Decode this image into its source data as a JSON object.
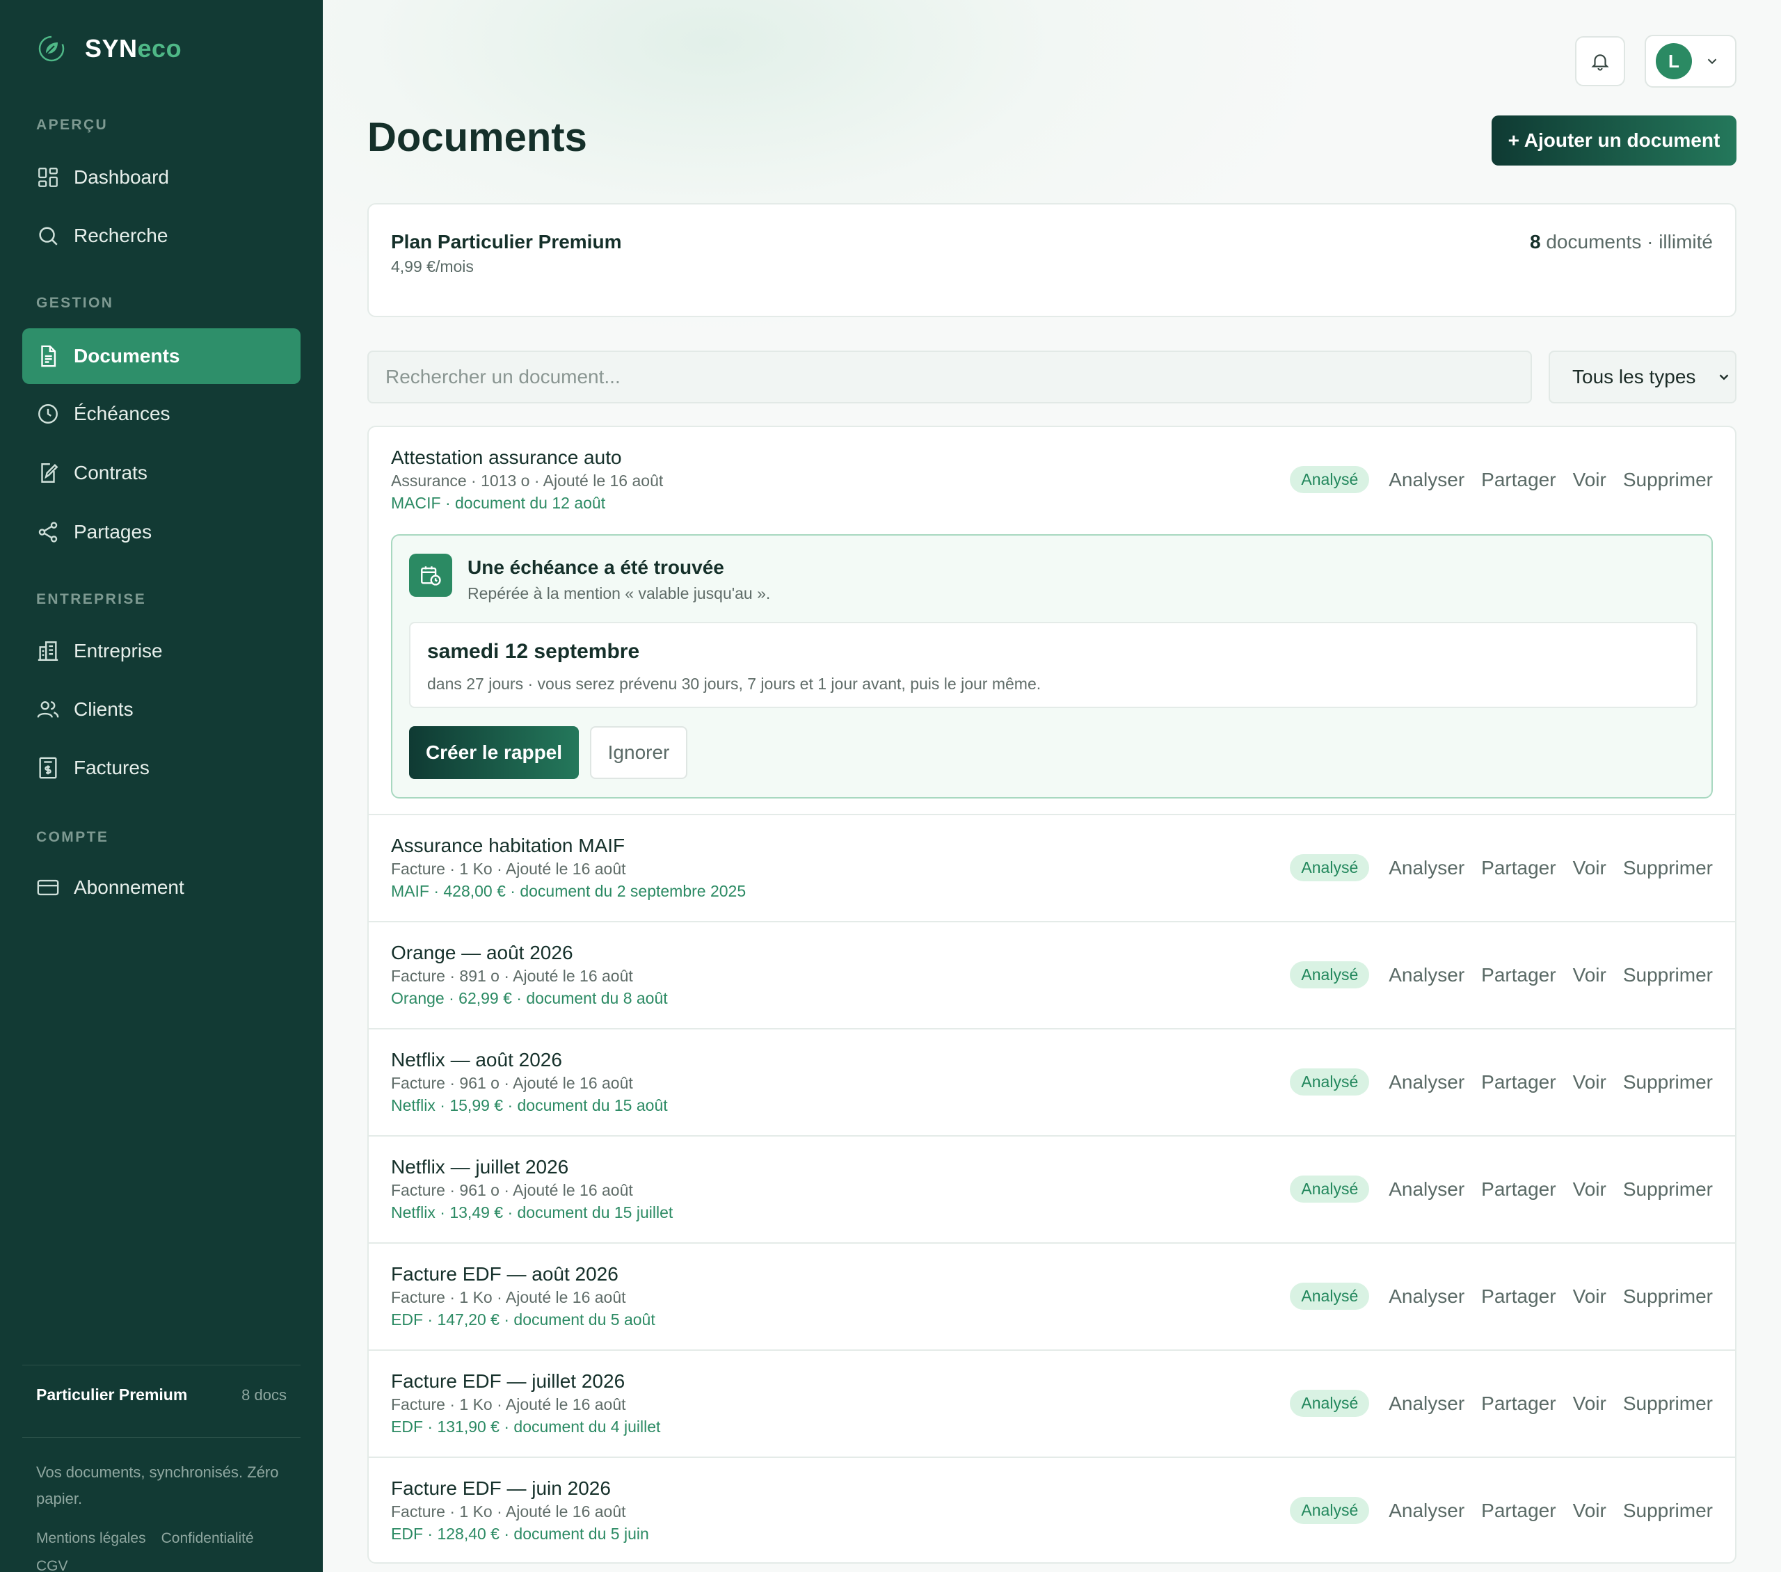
{
  "brand": {
    "name_main": "SYN",
    "name_accent": "eco"
  },
  "sidebar": {
    "sections": [
      {
        "label": "APERÇU"
      },
      {
        "label": "GESTION"
      },
      {
        "label": "ENTREPRISE"
      },
      {
        "label": "COMPTE"
      }
    ],
    "items": [
      {
        "label": "Dashboard",
        "icon": "dashboard-icon"
      },
      {
        "label": "Recherche",
        "icon": "search-icon"
      },
      {
        "label": "Documents",
        "icon": "document-icon",
        "active": true
      },
      {
        "label": "Échéances",
        "icon": "clock-icon"
      },
      {
        "label": "Contrats",
        "icon": "contract-icon"
      },
      {
        "label": "Partages",
        "icon": "share-icon"
      },
      {
        "label": "Entreprise",
        "icon": "building-icon"
      },
      {
        "label": "Clients",
        "icon": "users-icon"
      },
      {
        "label": "Factures",
        "icon": "invoice-icon"
      },
      {
        "label": "Abonnement",
        "icon": "credit-card-icon"
      }
    ],
    "plan": {
      "name": "Particulier Premium",
      "count": "8 docs"
    },
    "tagline": "Vos documents, synchronisés. Zéro papier.",
    "legal": [
      "Mentions légales",
      "Confidentialité",
      "CGV"
    ]
  },
  "header": {
    "user_initial": "L"
  },
  "page": {
    "title": "Documents",
    "add_button": "+ Ajouter un document"
  },
  "plan_card": {
    "name": "Plan Particulier Premium",
    "price": "4,99 €/mois",
    "doc_count": "8",
    "doc_suffix": "documents · illimité"
  },
  "search": {
    "placeholder": "Rechercher un document..."
  },
  "filter": {
    "selected": "Tous les types"
  },
  "actions": {
    "badge": "Analysé",
    "analyze": "Analyser",
    "share": "Partager",
    "view": "Voir",
    "delete": "Supprimer"
  },
  "documents": [
    {
      "title": "Attestation assurance auto",
      "meta": "Assurance · 1013 o · Ajouté le 16 août",
      "extra": "MACIF · document du 12 août"
    },
    {
      "title": "Assurance habitation MAIF",
      "meta": "Facture · 1 Ko · Ajouté le 16 août",
      "extra": "MAIF · 428,00 € · document du 2 septembre 2025"
    },
    {
      "title": "Orange — août 2026",
      "meta": "Facture · 891 o · Ajouté le 16 août",
      "extra": "Orange · 62,99 € · document du 8 août"
    },
    {
      "title": "Netflix — août 2026",
      "meta": "Facture · 961 o · Ajouté le 16 août",
      "extra": "Netflix · 15,99 € · document du 15 août"
    },
    {
      "title": "Netflix — juillet 2026",
      "meta": "Facture · 961 o · Ajouté le 16 août",
      "extra": "Netflix · 13,49 € · document du 15 juillet"
    },
    {
      "title": "Facture EDF — août 2026",
      "meta": "Facture · 1 Ko · Ajouté le 16 août",
      "extra": "EDF · 147,20 € · document du 5 août"
    },
    {
      "title": "Facture EDF — juillet 2026",
      "meta": "Facture · 1 Ko · Ajouté le 16 août",
      "extra": "EDF · 131,90 € · document du 4 juillet"
    },
    {
      "title": "Facture EDF — juin 2026",
      "meta": "Facture · 1 Ko · Ajouté le 16 août",
      "extra": "EDF · 128,40 € · document du 5 juin"
    }
  ],
  "deadline_alert": {
    "title": "Une échéance a été trouvée",
    "subtitle": "Repérée à la mention « valable jusqu'au ».",
    "date": "samedi 12 septembre",
    "details": "dans 27 jours · vous serez prévenu 30 jours, 7 jours et 1 jour avant, puis le jour même.",
    "create_button": "Créer le rappel",
    "ignore_button": "Ignorer"
  },
  "colors": {
    "sidebar_bg": "#123a34",
    "accent": "#2e8f6a",
    "badge_bg": "#d9f2e3",
    "badge_text": "#22875c"
  }
}
